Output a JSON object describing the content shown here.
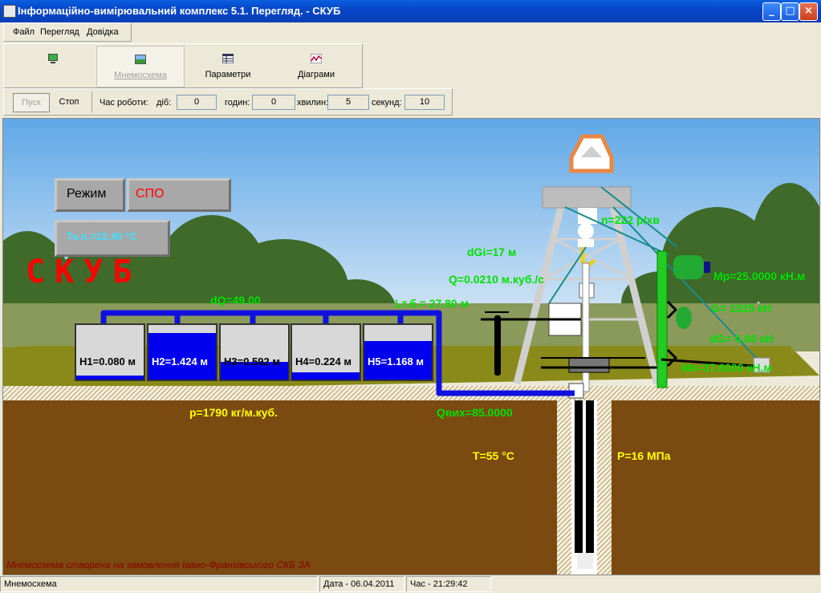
{
  "window": {
    "title": "Інформаційно-вимірювальний комплекс 5.1. Перегляд. - СКУБ"
  },
  "menu": {
    "items": [
      "Файл",
      "Перегляд",
      "Довідка"
    ]
  },
  "toolbar": {
    "tabs": [
      {
        "label": "",
        "icon": "computer-icon"
      },
      {
        "label": "Мнемосхема",
        "icon": "landscape-icon"
      },
      {
        "label": "Параметри",
        "icon": "table-icon"
      },
      {
        "label": "Діаграми",
        "icon": "chart-icon"
      }
    ]
  },
  "controls": {
    "start_label": "Пуск",
    "stop_label": "Стоп",
    "work_time_label": "Час роботи:",
    "days_label": "діб:",
    "days_value": "0",
    "hours_label": "годин:",
    "hours_value": "0",
    "minutes_label": "хвилин:",
    "minutes_value": "5",
    "seconds_label": "секунд:",
    "seconds_value": "10"
  },
  "scene": {
    "title": "СКУБ",
    "mode_label": "Режим",
    "mode_value": "СПО",
    "temp_reading": "Тк.п.=22.40 °С",
    "dQ": "dQ=49.00",
    "level_reading": "Lт.б.= 27.80 м",
    "dGi": "dGi=17 м",
    "Q": "Q=0.0210 м.куб./с",
    "n": "n=222 р/хв",
    "Mr": "Mр=25.0000 кН.м",
    "G": "G= 1525 кН",
    "dG": "dG= 0.00 кН",
    "Mk": "Mк=37.6000 кН.м",
    "density": "р=1790 кг/м.куб.",
    "Qout": "Qвих=85.0000",
    "T": "T=55 °С",
    "P": "P=16 МПа",
    "footer_note": "Мнемосхема створена на замовлення Івано-Франківського СКБ ЗА",
    "tanks": [
      {
        "label": "H1=0.080 м",
        "fill": 0.08
      },
      {
        "label": "H2=1.424 м",
        "fill": 0.85
      },
      {
        "label": "H3=0.592 м",
        "fill": 0.33
      },
      {
        "label": "H4=0.224 м",
        "fill": 0.13
      },
      {
        "label": "H5=1.168 м",
        "fill": 0.7
      }
    ]
  },
  "status": {
    "mode": "Мнемосхема",
    "date": "Дата - 06.04.2011",
    "time": "Час - 21:29:42"
  },
  "colors": {
    "tank_fill": "#0000ee",
    "pipe": "#1010e0",
    "readout_green": "#00e000",
    "readout_yellow": "#ffff00",
    "title_red": "#ff0000",
    "ground": "#7a4a10"
  }
}
